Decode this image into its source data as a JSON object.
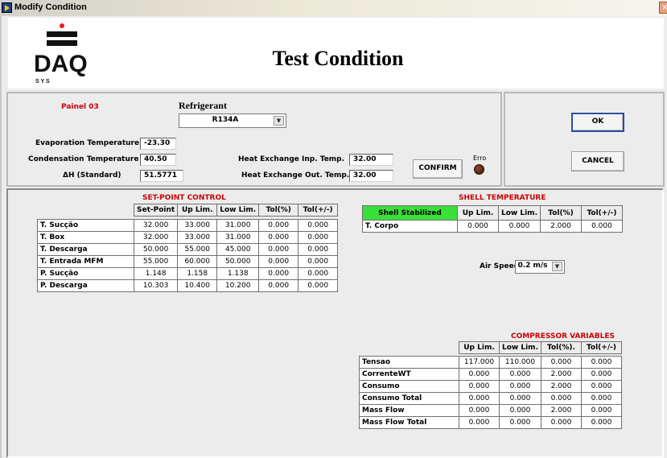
{
  "window": {
    "title": "Modify Condition"
  },
  "header": {
    "logo_text": "DAQ",
    "logo_sub": "S  Y  S",
    "title": "Test Condition"
  },
  "top_panel": {
    "panel_label": "Painel 03",
    "refrigerant_label": "Refrigerant",
    "refrigerant_value": "R134A",
    "evap_label": "Evaporation Temperature",
    "evap_value": "-23.30",
    "cond_label": "Condensation Temperature",
    "cond_value": "40.50",
    "dh_label": "ΔH (Standard)",
    "dh_value": "51.5771",
    "hx_inp_label": "Heat Exchange Inp. Temp.",
    "hx_inp_value": "32.00",
    "hx_out_label": "Heat Exchange Out. Temp.",
    "hx_out_value": "32.00",
    "confirm_label": "CONFIRM",
    "erro_label": "Erro"
  },
  "actions": {
    "ok_label": "OK",
    "cancel_label": "CANCEL"
  },
  "setpoint": {
    "title": "SET-POINT CONTROL",
    "headers": [
      "Set-Point",
      "Up Lim.",
      "Low Lim.",
      "Tol(%)",
      "Tol(+/-)"
    ],
    "rows": [
      {
        "label": "T. Sucção",
        "values": [
          "32.000",
          "33.000",
          "31.000",
          "0.000",
          "0.000"
        ]
      },
      {
        "label": "T. Box",
        "values": [
          "32.000",
          "33.000",
          "31.000",
          "0.000",
          "0.000"
        ]
      },
      {
        "label": "T. Descarga",
        "values": [
          "50.000",
          "55.000",
          "45.000",
          "0.000",
          "0.000"
        ]
      },
      {
        "label": "T. Entrada MFM",
        "values": [
          "55.000",
          "60.000",
          "50.000",
          "0.000",
          "0.000"
        ]
      },
      {
        "label": "P. Sucção",
        "values": [
          "1.148",
          "1.158",
          "1.138",
          "0.000",
          "0.000"
        ]
      },
      {
        "label": "P. Descarga",
        "values": [
          "10.303",
          "10.400",
          "10.200",
          "0.000",
          "0.000"
        ]
      }
    ]
  },
  "shell": {
    "title": "SHELL TEMPERATURE",
    "stabilized_label": "Shell Stabilized",
    "headers": [
      "Up Lim.",
      "Low Lim.",
      "Tol(%)",
      "Tol(+/-)"
    ],
    "row_label": "T. Corpo",
    "values": [
      "0.000",
      "0.000",
      "2.000",
      "0.000"
    ],
    "air_speed_label": "Air Speed",
    "air_speed_value": "0.2 m/s"
  },
  "compressor": {
    "title": "COMPRESSOR VARIABLES",
    "headers": [
      "Up Lim.",
      "Low Lim.",
      "Tol(%).",
      "Tol(+/-)"
    ],
    "rows": [
      {
        "label": "Tensao",
        "values": [
          "117.000",
          "110.000",
          "0.000",
          "0.000"
        ]
      },
      {
        "label": "CorrenteWT",
        "values": [
          "0.000",
          "0.000",
          "2.000",
          "0.000"
        ]
      },
      {
        "label": "Consumo",
        "values": [
          "0.000",
          "0.000",
          "2.000",
          "0.000"
        ]
      },
      {
        "label": "Consumo Total",
        "values": [
          "0.000",
          "0.000",
          "0.000",
          "0.000"
        ]
      },
      {
        "label": "Mass Flow",
        "values": [
          "0.000",
          "0.000",
          "2.000",
          "0.000"
        ]
      },
      {
        "label": "Mass Flow Total",
        "values": [
          "0.000",
          "0.000",
          "0.000",
          "0.000"
        ]
      }
    ]
  },
  "colors": {
    "accent_red": "#cc0000",
    "stabilized_green": "#39e039",
    "led_off": "#5a2410"
  },
  "icons": {
    "window": "labview-run-icon",
    "close": "close-icon",
    "dropdown": "chevron-down-icon"
  }
}
